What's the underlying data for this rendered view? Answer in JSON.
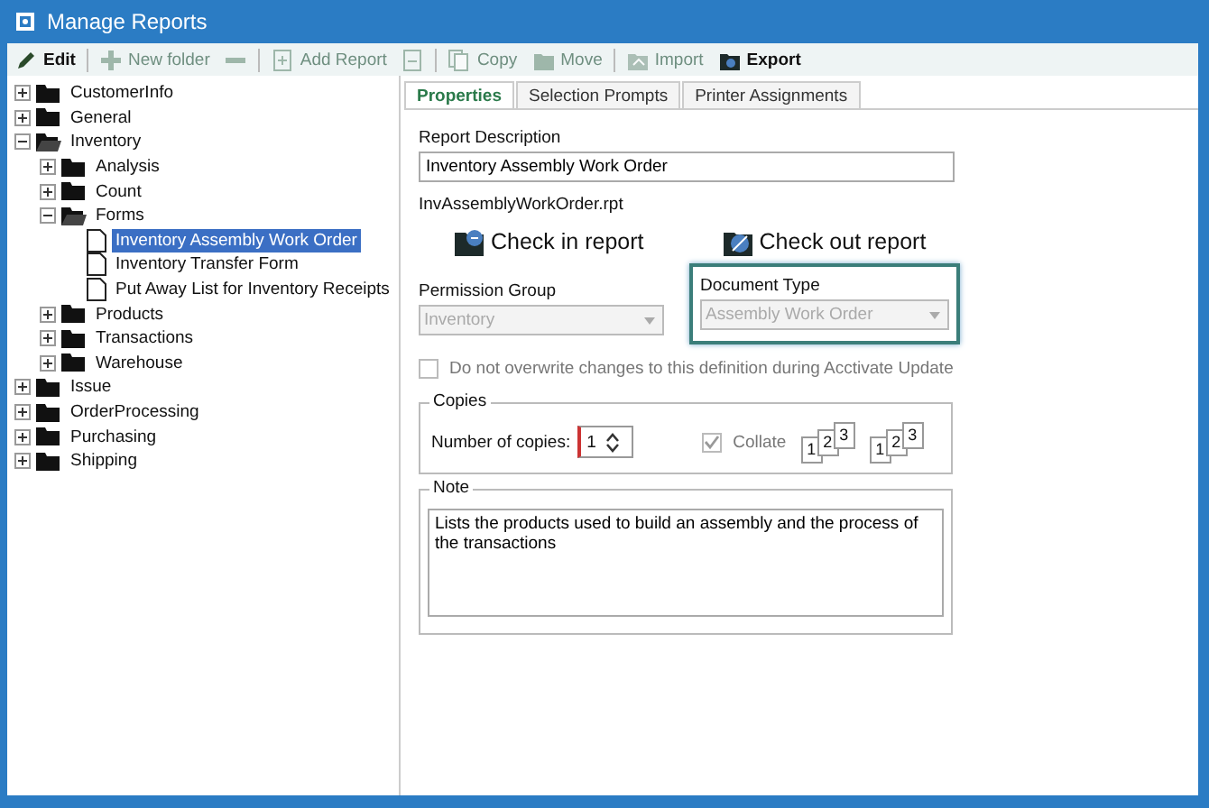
{
  "window": {
    "title": "Manage Reports"
  },
  "toolbar": [
    {
      "kind": "edit",
      "label": "Edit",
      "disabled": false
    },
    {
      "kind": "separator"
    },
    {
      "kind": "new-folder",
      "label": "New folder",
      "disabled": true
    },
    {
      "kind": "remove",
      "disabled": true
    },
    {
      "kind": "separator"
    },
    {
      "kind": "add-report",
      "label": "Add Report",
      "disabled": true
    },
    {
      "kind": "report",
      "disabled": true
    },
    {
      "kind": "separator"
    },
    {
      "kind": "copy",
      "label": "Copy",
      "disabled": true
    },
    {
      "kind": "move",
      "label": "Move",
      "disabled": true
    },
    {
      "kind": "separator"
    },
    {
      "kind": "import",
      "label": "Import",
      "disabled": true
    },
    {
      "kind": "export",
      "label": "Export",
      "disabled": false
    }
  ],
  "tree": [
    {
      "kind": "folder",
      "label": "CustomerInfo",
      "expanded": false,
      "selected": false
    },
    {
      "kind": "folder",
      "label": "General",
      "expanded": false,
      "selected": false
    },
    {
      "kind": "folder",
      "label": "Inventory",
      "expanded": true,
      "selected": false,
      "children": [
        {
          "kind": "folder",
          "label": "Analysis",
          "expanded": false,
          "selected": false
        },
        {
          "kind": "folder",
          "label": "Count",
          "expanded": false,
          "selected": false
        },
        {
          "kind": "folder",
          "label": "Forms",
          "expanded": true,
          "selected": false,
          "children": [
            {
              "kind": "report",
              "label": "Inventory Assembly Work Order",
              "selected": true
            },
            {
              "kind": "report",
              "label": "Inventory Transfer Form",
              "selected": false
            },
            {
              "kind": "report",
              "label": "Put Away List for Inventory Receipts",
              "selected": false
            }
          ]
        },
        {
          "kind": "folder",
          "label": "Products",
          "expanded": false,
          "selected": false
        },
        {
          "kind": "folder",
          "label": "Transactions",
          "expanded": false,
          "selected": false
        },
        {
          "kind": "folder",
          "label": "Warehouse",
          "expanded": false,
          "selected": false
        }
      ]
    },
    {
      "kind": "folder",
      "label": "Issue",
      "expanded": false,
      "selected": false
    },
    {
      "kind": "folder",
      "label": "OrderProcessing",
      "expanded": false,
      "selected": false
    },
    {
      "kind": "folder",
      "label": "Purchasing",
      "expanded": false,
      "selected": false
    },
    {
      "kind": "folder",
      "label": "Shipping",
      "expanded": false,
      "selected": false
    }
  ],
  "tabs": [
    {
      "label": "Properties",
      "selected": true
    },
    {
      "label": "Selection Prompts",
      "selected": false
    },
    {
      "label": "Printer Assignments",
      "selected": false
    }
  ],
  "report_description": {
    "label": "Report Description",
    "value": "Inventory Assembly Work Order"
  },
  "file_name": "InvAssemblyWorkOrder.rpt",
  "actions": [
    {
      "kind": "check-in",
      "label": "Check in report"
    },
    {
      "kind": "check-out",
      "label": "Check out report"
    }
  ],
  "permission_group": {
    "label": "Permission Group",
    "value": "Inventory",
    "disabled": true
  },
  "document_type": {
    "label": "Document Type",
    "value": "Assembly Work Order",
    "disabled": true,
    "focused": true
  },
  "overwrite_option": {
    "label": "Do not overwrite changes to this definition during Acctivate Update",
    "checked": false,
    "disabled": true
  },
  "copies": {
    "title": "Copies",
    "number_label": "Number of copies:",
    "number_value": "1",
    "collate": {
      "label": "Collate",
      "checked": true,
      "disabled": true
    },
    "collate_pages": [
      [
        "1",
        "2",
        "3"
      ],
      [
        "1",
        "2",
        "3"
      ]
    ]
  },
  "note": {
    "title": "Note",
    "value": "Lists the products used to build an assembly and the process of the transactions"
  }
}
